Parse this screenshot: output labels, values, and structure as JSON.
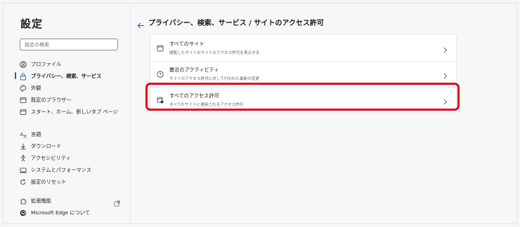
{
  "sidebar": {
    "title": "設定",
    "search_placeholder": "設定の検索",
    "items": [
      {
        "label": "プロファイル",
        "icon": "profile-icon"
      },
      {
        "label": "プライバシー、検索、サービス",
        "icon": "lock-icon",
        "active": true
      },
      {
        "label": "外観",
        "icon": "appearance-icon"
      },
      {
        "label": "既定のブラウザー",
        "icon": "browser-icon"
      },
      {
        "label": "スタート、ホーム、新しいタブ ページ",
        "icon": "home-icon"
      },
      {
        "label": "言語",
        "icon": "language-icon"
      },
      {
        "label": "ダウンロード",
        "icon": "download-icon"
      },
      {
        "label": "アクセシビリティ",
        "icon": "accessibility-icon"
      },
      {
        "label": "システムとパフォーマンス",
        "icon": "system-icon"
      },
      {
        "label": "設定のリセット",
        "icon": "reset-icon"
      },
      {
        "label": "拡張機能",
        "icon": "extensions-icon"
      },
      {
        "label": "Microsoft Edge について",
        "icon": "edge-icon"
      }
    ]
  },
  "main": {
    "breadcrumb": "プライバシー、検索、サービス / サイトのアクセス許可",
    "rows": [
      {
        "title": "すべてのサイト",
        "desc": "閲覧したサイトのサイトのアクセス許可を表示する",
        "icon": "site-icon"
      },
      {
        "title": "最近のアクティビティ",
        "desc": "サイトのアクセス許可に対して行われた最新の変更",
        "icon": "clock-icon"
      },
      {
        "title": "すべてのアクセス許可",
        "desc": "すべてのサイトに適用されるアクセス許可",
        "icon": "permissions-icon"
      }
    ]
  },
  "colors": {
    "accent": "#0f6cbd",
    "highlight": "#e3001b"
  }
}
